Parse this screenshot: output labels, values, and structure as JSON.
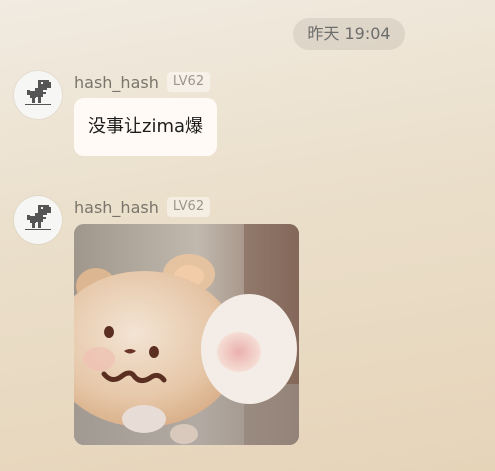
{
  "chat": {
    "timestamp": "昨天 19:04",
    "messages": [
      {
        "username": "hash_hash",
        "level": "LV62",
        "avatar_icon": "dinosaur-icon",
        "text": "没事让zima爆"
      },
      {
        "username": "hash_hash",
        "level": "LV62",
        "avatar_icon": "dinosaur-icon",
        "sticker": "hamster-sticker"
      }
    ]
  },
  "colors": {
    "bubble_bg": "#fffaf5",
    "username": "#7a746c",
    "level_text": "#9c958b"
  }
}
